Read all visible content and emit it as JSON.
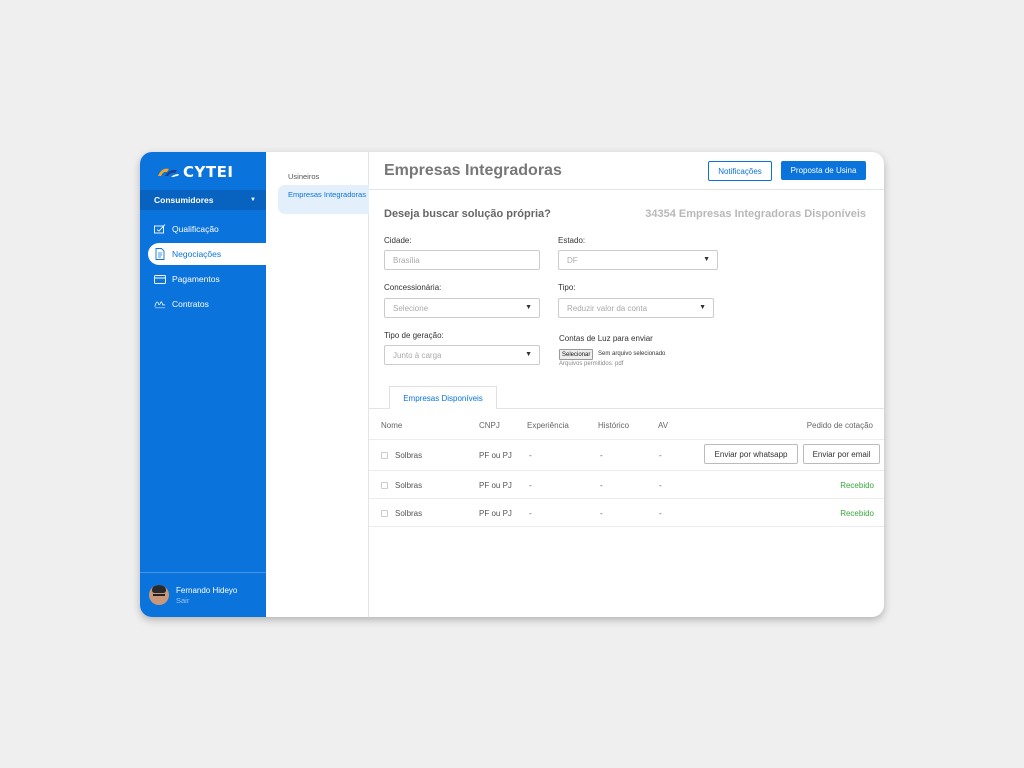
{
  "brand": {
    "name": "CYTEI"
  },
  "sidebar": {
    "section": "Consumidores",
    "items": [
      {
        "label": "Qualificação",
        "icon": "checklist-icon"
      },
      {
        "label": "Negociações",
        "icon": "document-icon"
      },
      {
        "label": "Pagamentos",
        "icon": "card-icon"
      },
      {
        "label": "Contratos",
        "icon": "signature-icon"
      }
    ],
    "active_item": "Negociações",
    "user": {
      "name": "Fernando Hideyo",
      "logout": "Sair"
    }
  },
  "subnav": {
    "items": [
      "Usineiros",
      "Empresas Integradoras"
    ],
    "active": "Empresas Integradoras"
  },
  "header": {
    "title": "Empresas Integradoras",
    "notifications_label": "Notificações",
    "proposal_label": "Proposta de Usina"
  },
  "search": {
    "question": "Deseja buscar solução própria?",
    "available": "34354 Empresas Integradoras Disponíveis",
    "city": {
      "label": "Cidade:",
      "placeholder": "Brasília"
    },
    "state": {
      "label": "Estado:",
      "value": "DF"
    },
    "utility": {
      "label": "Concessionária:",
      "value": "Selecione"
    },
    "type": {
      "label": "Tipo:",
      "value": "Reduzir valor da conta"
    },
    "generation": {
      "label": "Tipo de geração:",
      "value": "Junto à carga"
    },
    "bills": {
      "label": "Contas de Luz para enviar",
      "button": "Selecionar",
      "status": "Sem arquivo selecionado",
      "hint": "Arquivos permitidos: pdf"
    }
  },
  "tab": {
    "label": "Empresas Disponíveis"
  },
  "table": {
    "headers": {
      "name": "Nome",
      "cnpj": "CNPJ",
      "experience": "Experiência",
      "history": "Histórico",
      "av": "AV",
      "quote": "Pedido de cotação"
    },
    "rows": [
      {
        "name": "Solbras",
        "cnpj": "PF ou PJ",
        "experience": "-",
        "history": "-",
        "av": "-",
        "whatsapp": "Enviar por whatsapp",
        "email": "Enviar por email"
      },
      {
        "name": "Solbras",
        "cnpj": "PF ou PJ",
        "experience": "-",
        "history": "-",
        "av": "-",
        "status": "Recebido"
      },
      {
        "name": "Solbras",
        "cnpj": "PF ou PJ",
        "experience": "-",
        "history": "-",
        "av": "-",
        "status": "Recebido"
      }
    ]
  },
  "colors": {
    "primary": "#0a73dc",
    "success": "#3aa53a",
    "background": "#efefef"
  }
}
